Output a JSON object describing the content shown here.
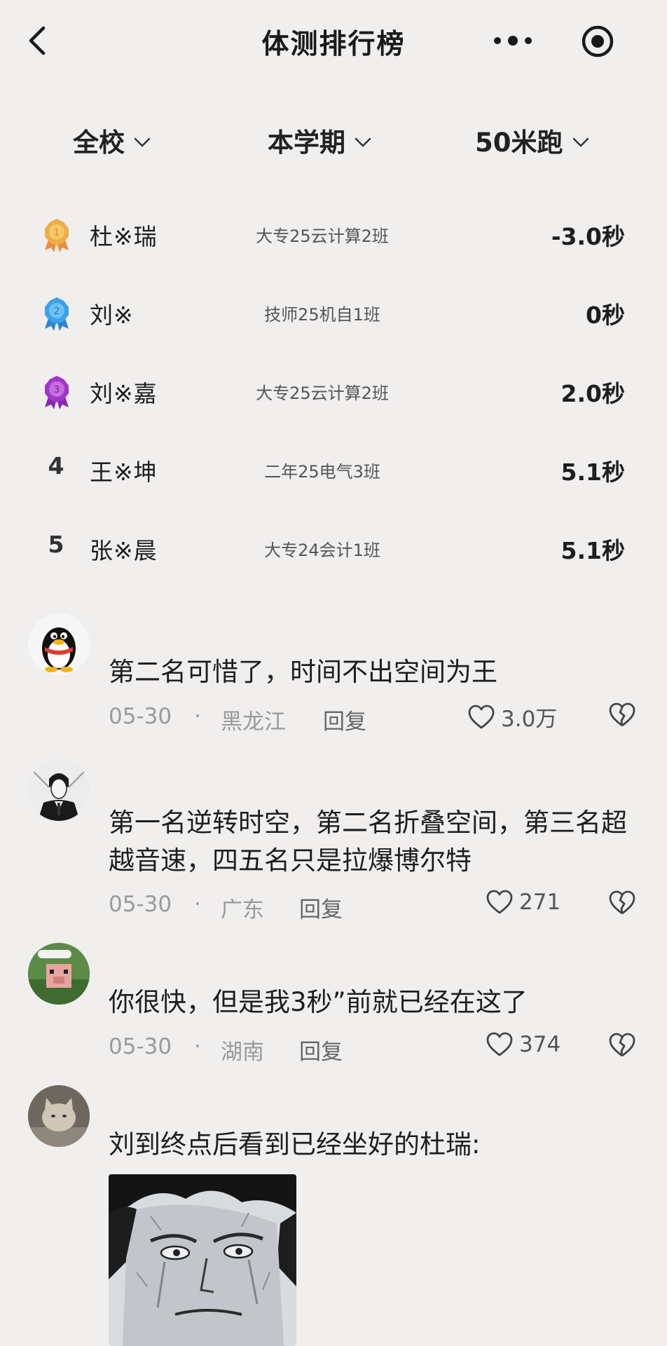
{
  "header": {
    "title": "体测排行榜",
    "icons": [
      "back-icon",
      "more-icon",
      "capsule-icon"
    ]
  },
  "filters": {
    "scope": "全校",
    "period": "本学期",
    "event": "50米跑"
  },
  "rankings": [
    {
      "rank": "1",
      "badge": "gold-medal-icon",
      "name": "杜※瑞",
      "class": "大专25云计算2班",
      "score": "-3.0秒"
    },
    {
      "rank": "2",
      "badge": "silver-medal-icon",
      "name": "刘※",
      "class": "技师25机自1班",
      "score": "0秒"
    },
    {
      "rank": "3",
      "badge": "bronze-medal-icon",
      "name": "刘※嘉",
      "class": "大专25云计算2班",
      "score": "2.0秒"
    },
    {
      "rank": "4",
      "name": "王※坤",
      "class": "二年25电气3班",
      "score": "5.1秒"
    },
    {
      "rank": "5",
      "name": "张※晨",
      "class": "大专24会计1班",
      "score": "5.1秒"
    }
  ],
  "comments": [
    {
      "text": "第二名可惜了，时间不出空间为王",
      "date": "05-30",
      "separator": "·",
      "location": "黑龙江",
      "reply": "回复",
      "likes": "3.0万"
    },
    {
      "text": "第一名逆转时空，第二名折叠空间，第三名超越音速，四五名只是拉爆博尔特",
      "date": "05-30",
      "separator": "·",
      "location": "广东",
      "reply": "回复",
      "likes": "271"
    },
    {
      "text": "你很快，但是我3秒”前就已经在这了",
      "date": "05-30",
      "separator": "·",
      "location": "湖南",
      "reply": "回复",
      "likes": "374"
    },
    {
      "text": "刘到终点后看到已经坐好的杜瑞:"
    }
  ],
  "colors": {
    "background": "#f1efee",
    "gold": "#e8a63c",
    "silver": "#3aa3e8",
    "bronze": "#a236c8",
    "meta_gray": "#9a9a9a"
  }
}
